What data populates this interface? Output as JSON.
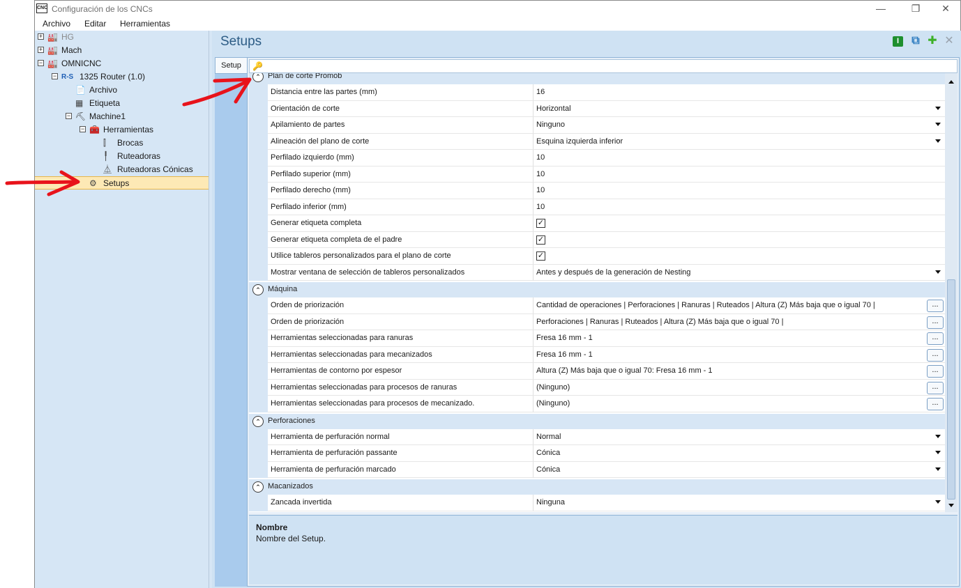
{
  "window": {
    "title": "Configuración de los CNCs",
    "app_icon_text": "CNC",
    "controls": {
      "minimize": "—",
      "restore": "❐",
      "close": "✕"
    }
  },
  "menubar": {
    "items": [
      "Archivo",
      "Editar",
      "Herramientas"
    ]
  },
  "tree": {
    "nodes": [
      {
        "label": "HG",
        "icon": "factory-icon",
        "expander": "+"
      },
      {
        "label": "Mach",
        "icon": "factory-icon",
        "expander": "+"
      },
      {
        "label": "OMNICNC",
        "icon": "factory-icon",
        "expander": "−"
      },
      {
        "label": "1325 Router (1.0)",
        "icon": "router-logo-icon",
        "icon_text": "R-S",
        "expander": "−"
      },
      {
        "label": "Archivo",
        "icon": "document-icon"
      },
      {
        "label": "Etiqueta",
        "icon": "label-icon"
      },
      {
        "label": "Machine1",
        "icon": "machine-icon",
        "expander": "−"
      },
      {
        "label": "Herramientas",
        "icon": "toolbox-icon",
        "expander": "−"
      },
      {
        "label": "Brocas",
        "icon": "drill-bit-icon"
      },
      {
        "label": "Ruteadoras",
        "icon": "router-bit-icon"
      },
      {
        "label": "Ruteadoras Cónicas",
        "icon": "conical-bit-icon"
      },
      {
        "label": "Setups",
        "icon": "gear-icon",
        "selected": true
      }
    ]
  },
  "header": {
    "title": "Setups",
    "buttons": [
      {
        "name": "info-button",
        "glyph": "I",
        "color": "#1e8f2e"
      },
      {
        "name": "copy-button",
        "glyph": "⧉",
        "color": "#2f7dc0"
      },
      {
        "name": "add-button",
        "glyph": "✚",
        "color": "#3db027"
      },
      {
        "name": "delete-button",
        "glyph": "✕",
        "color": "#9aa3ad"
      }
    ]
  },
  "tabs": [
    {
      "label": "Setup",
      "active": true
    }
  ],
  "search": {
    "icon": "search-key-icon",
    "value": ""
  },
  "categories": [
    {
      "label": "Plan de corte Promob",
      "rows": [
        {
          "name": "Distancia entre las partes (mm)",
          "value": "16",
          "editor": "text"
        },
        {
          "name": "Orientación de corte",
          "value": "Horizontal",
          "editor": "dropdown"
        },
        {
          "name": "Apilamiento de partes",
          "value": "Ninguno",
          "editor": "dropdown"
        },
        {
          "name": "Alineación del plano de corte",
          "value": "Esquina izquierda inferior",
          "editor": "dropdown"
        },
        {
          "name": "Perfilado izquierdo (mm)",
          "value": "10",
          "editor": "text"
        },
        {
          "name": "Perfilado superior (mm)",
          "value": "10",
          "editor": "text"
        },
        {
          "name": "Perfilado derecho (mm)",
          "value": "10",
          "editor": "text"
        },
        {
          "name": "Perfilado inferior (mm)",
          "value": "10",
          "editor": "text"
        },
        {
          "name": "Generar etiqueta completa",
          "value": "",
          "editor": "checkbox",
          "checked": true
        },
        {
          "name": "Generar etiqueta completa de el padre",
          "value": "",
          "editor": "checkbox",
          "checked": true
        },
        {
          "name": "Utilice tableros personalizados para el plano de corte",
          "value": "",
          "editor": "checkbox",
          "checked": true
        },
        {
          "name": "Mostrar ventana de selección de tableros personalizados",
          "value": "Antes y después de la generación de Nesting",
          "editor": "dropdown"
        }
      ]
    },
    {
      "label": "Máquina",
      "rows": [
        {
          "name": "Orden de priorización",
          "value": "Cantidad de operaciones | Perforaciones | Ranuras | Ruteados | Altura (Z) Más baja que o igual 70 |",
          "editor": "ellipsis"
        },
        {
          "name": "Orden de priorización",
          "value": "Perforaciones | Ranuras | Ruteados | Altura (Z) Más baja que o igual 70 |",
          "editor": "ellipsis"
        },
        {
          "name": "Herramientas seleccionadas para ranuras",
          "value": "Fresa 16 mm - 1",
          "editor": "ellipsis"
        },
        {
          "name": "Herramientas seleccionadas para mecanizados",
          "value": "Fresa 16 mm - 1",
          "editor": "ellipsis"
        },
        {
          "name": "Herramientas de contorno por espesor",
          "value": "Altura (Z) Más baja que o igual 70: Fresa 16 mm - 1",
          "editor": "ellipsis"
        },
        {
          "name": "Herramientas seleccionadas para procesos de ranuras",
          "value": "(Ninguno)",
          "editor": "ellipsis"
        },
        {
          "name": "Herramientas seleccionadas para procesos de mecanizado.",
          "value": "(Ninguno)",
          "editor": "ellipsis"
        }
      ]
    },
    {
      "label": "Perforaciones",
      "rows": [
        {
          "name": "Herramienta de perfuración normal",
          "value": "Normal",
          "editor": "dropdown"
        },
        {
          "name": "Herramienta de perfuración passante",
          "value": "Cónica",
          "editor": "dropdown"
        },
        {
          "name": "Herramienta de perfuración marcado",
          "value": "Cónica",
          "editor": "dropdown"
        }
      ]
    },
    {
      "label": "Macanizados",
      "rows": [
        {
          "name": "Zancada invertida",
          "value": "Ninguna",
          "editor": "dropdown"
        }
      ]
    }
  ],
  "ellipsis_label": "...",
  "checkbox_mark": "✓",
  "collapse_glyph": "︿",
  "description": {
    "name": "Nombre",
    "text": "Nombre del Setup."
  },
  "annotation_color": "#e8131b"
}
